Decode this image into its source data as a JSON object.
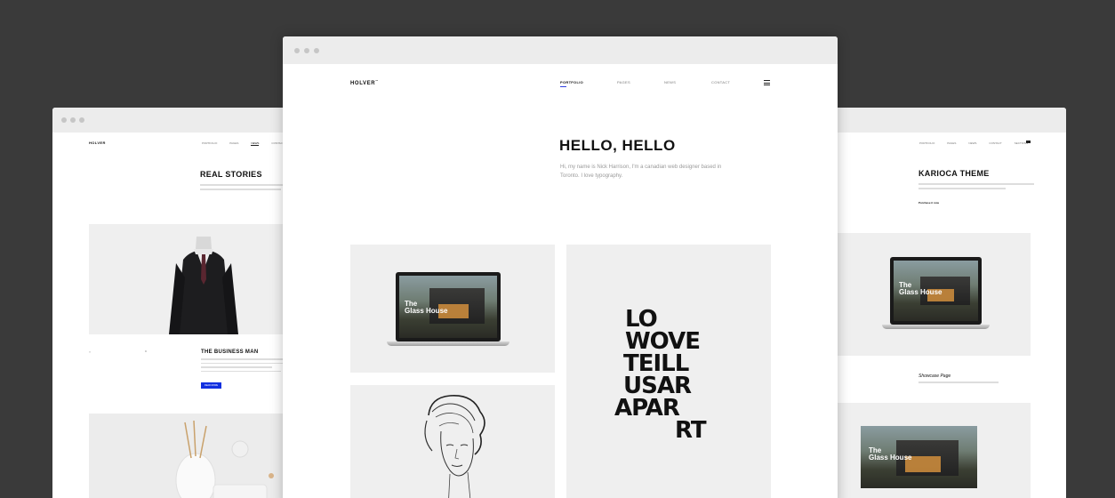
{
  "center": {
    "logo": "HOLVER",
    "logo_mark": "™",
    "nav": [
      "PORTFOLIO",
      "PAGES",
      "NEWS",
      "CONTACT"
    ],
    "headline": "HELLO, HELLO",
    "intro": "Hi, my name is Nick Harrison, I'm a canadian web designer based in Toronto. I love typography.",
    "laptop_title": "The\nGlass House",
    "poster_lines": [
      "LO",
      "WOVE",
      "TEILL",
      "USAR",
      "APAR",
      "RT"
    ]
  },
  "left": {
    "logo": "HOLVER",
    "nav": [
      "PORTFOLIO",
      "PAGES",
      "NEWS",
      "CONTACT"
    ],
    "title": "REAL STORIES",
    "card_title": "THE BUSINESS MAN",
    "button": "READ MORE"
  },
  "right": {
    "nav": [
      "PORTFOLIO",
      "PAGES",
      "NEWS",
      "CONTACT",
      "SECTIONS"
    ],
    "title": "KARIOCA THEME",
    "link": "Purchase it now",
    "showcase_title": "Showcase Page",
    "laptop_title": "The\nGlass House",
    "banner_title": "The\nGlass House"
  },
  "colors": {
    "accent": "#1230e0",
    "background": "#3a3a3a"
  }
}
